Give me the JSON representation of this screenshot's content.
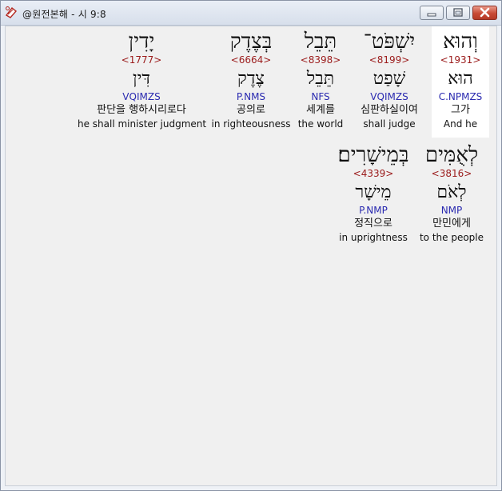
{
  "window": {
    "title": "@원전본해 - 시 9:8",
    "controls": {
      "minimize_icon": "minimize-icon",
      "maximize_icon": "maximize-icon",
      "close_icon": "close-icon"
    }
  },
  "colors": {
    "strong": "#9b1b1b",
    "parse": "#2a2ab0",
    "close_button": "#c84a35"
  },
  "words": [
    {
      "hebrew": "וְהוּא",
      "strong": "<1931>",
      "lemma": "הוּא",
      "parse": "C.NPMZS",
      "korean": "그가",
      "english": "And he",
      "selected": true
    },
    {
      "hebrew": "יִשְׁפֹּט־",
      "strong": "<8199>",
      "lemma": "שָׁפַט",
      "parse": "VQIMZS",
      "korean": "심판하실이여",
      "english": "shall judge"
    },
    {
      "hebrew": "תֵּבֵל",
      "strong": "<8398>",
      "lemma": "תֵּבֵל",
      "parse": "NFS",
      "korean": "세계를",
      "english": "the world"
    },
    {
      "hebrew": "בְּצֶדֶק",
      "strong": "<6664>",
      "lemma": "צֶדֶק",
      "parse": "P.NMS",
      "korean": "공의로",
      "english": "in righteousness"
    },
    {
      "hebrew": "יָדִין",
      "strong": "<1777>",
      "lemma": "דִּין",
      "parse": "VQIMZS",
      "korean": "판단을 행하시리로다",
      "english": "he shall minister judgment"
    },
    {
      "hebrew": "לְאֻמִּים",
      "strong": "<3816>",
      "lemma": "לְאֹם",
      "parse": "NMP",
      "korean": "만민에게",
      "english": "to the people"
    },
    {
      "hebrew": "בְּמֵישָׁרִים׃",
      "strong": "<4339>",
      "lemma": "מֵישָׁר",
      "parse": "P.NMP",
      "korean": "정직으로",
      "english": "in uprightness"
    }
  ]
}
